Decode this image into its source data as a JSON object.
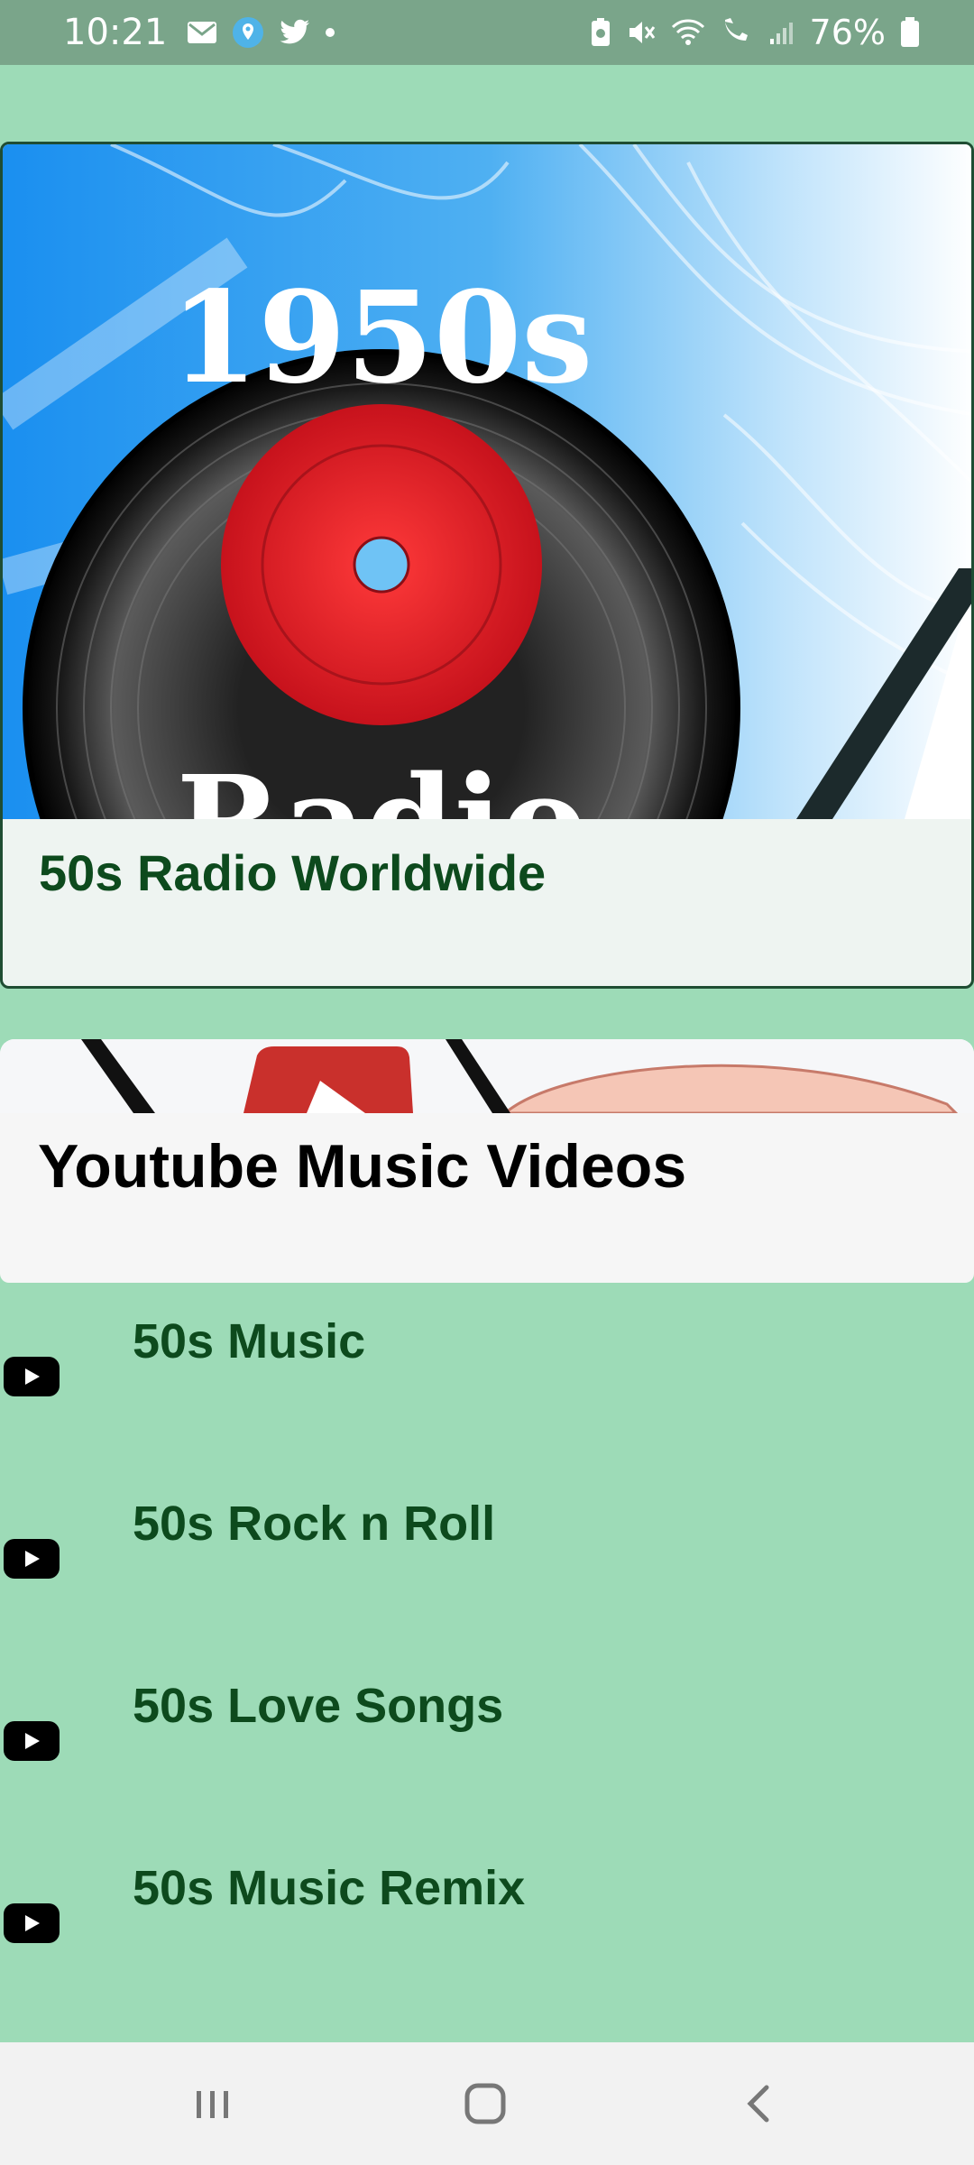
{
  "status_bar": {
    "time": "10:21",
    "icons_left": [
      "mail-icon",
      "location-pin-icon",
      "twitter-icon",
      "dot-icon"
    ],
    "icons_right": [
      "battery-saver-icon",
      "mute-icon",
      "wifi-icon",
      "wifi-calling-icon",
      "signal-icon"
    ],
    "battery": "76%"
  },
  "radio_card": {
    "art_text_top": "1950s",
    "art_text_bottom": "Radio",
    "title": "50s Radio Worldwide"
  },
  "youtube_card": {
    "title": "Youtube Music Videos",
    "items": [
      {
        "label": "50s Music",
        "icon": "youtube-play-icon"
      },
      {
        "label": "50s Rock n Roll",
        "icon": "youtube-play-icon"
      },
      {
        "label": "50s Love Songs",
        "icon": "youtube-play-icon"
      },
      {
        "label": "50s Music Remix",
        "icon": "youtube-play-icon"
      }
    ]
  },
  "nav_bar": {
    "buttons": [
      "recent-apps-icon",
      "home-icon",
      "back-icon"
    ]
  },
  "colors": {
    "background": "#9ddbb7",
    "status_bar": "#7aa58a",
    "title_green": "#0d4a1d",
    "vinyl_label_red": "#e8202a"
  }
}
